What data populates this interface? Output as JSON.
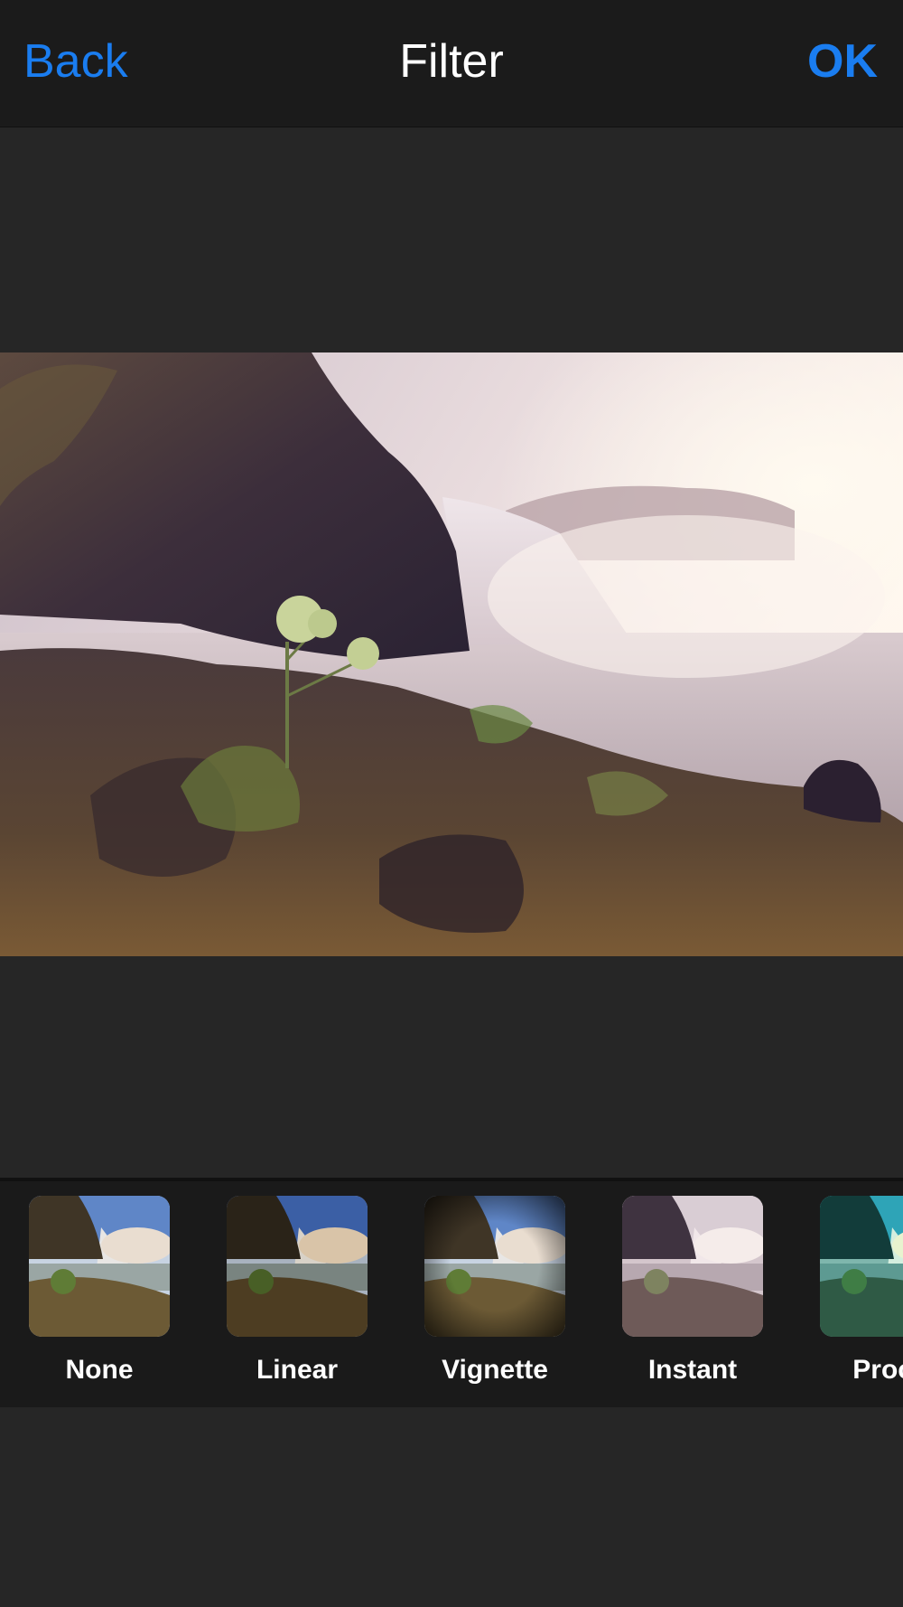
{
  "navbar": {
    "back_label": "Back",
    "title": "Filter",
    "ok_label": "OK"
  },
  "colors": {
    "accent": "#1a7df0",
    "navbar_bg": "#1b1b1b",
    "page_bg": "#262626",
    "strip_bg": "#1a1a1a"
  },
  "preview": {
    "subject": "waterfall-landscape-photo"
  },
  "filters": [
    {
      "label": "None"
    },
    {
      "label": "Linear"
    },
    {
      "label": "Vignette"
    },
    {
      "label": "Instant"
    },
    {
      "label": "Proce"
    }
  ]
}
